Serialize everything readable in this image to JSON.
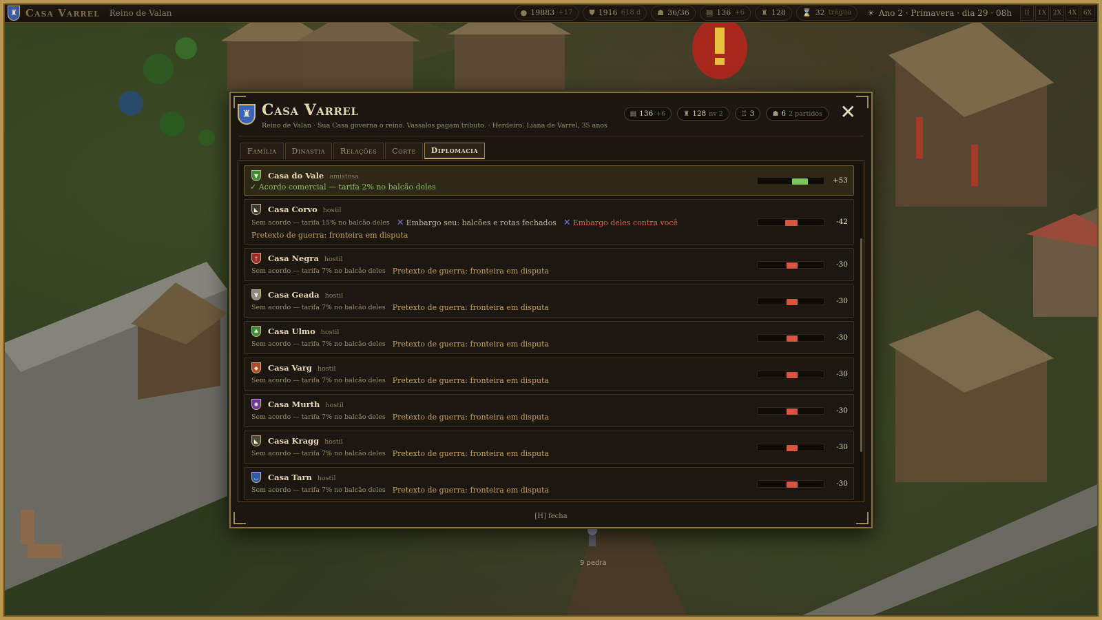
{
  "topbar": {
    "title": "Casa Varrel",
    "realm": "Reino de Valan",
    "stats": [
      {
        "icon": "gold-icon",
        "glyph": "●",
        "value": "19883",
        "delta": "+17"
      },
      {
        "icon": "shield-icon",
        "glyph": "⛊",
        "value": "1916",
        "delta": "618 d"
      },
      {
        "icon": "population-icon",
        "glyph": "☗",
        "value": "36/36",
        "delta": ""
      },
      {
        "icon": "scroll-icon",
        "glyph": "▤",
        "value": "136",
        "delta": "+6"
      },
      {
        "icon": "prestige-icon",
        "glyph": "♜",
        "value": "128",
        "delta": ""
      },
      {
        "icon": "hourglass-icon",
        "glyph": "⌛",
        "value": "32",
        "delta": "trégua"
      }
    ],
    "date": "Ano 2 · Primavera · dia 29 · 08h",
    "speeds": [
      "II",
      "1X",
      "2X",
      "4X",
      "6X"
    ]
  },
  "dialog": {
    "title": "Casa Varrel",
    "subtitle": "Reino de Valan · Sua Casa governa o reino. Vassalos pagam tributo. · Herdeiro: Liana de Varrel, 35 anos",
    "stats": [
      {
        "icon": "scroll-icon",
        "glyph": "▤",
        "value": "136",
        "delta": "+6"
      },
      {
        "icon": "prestige-icon",
        "glyph": "♜",
        "value": "128",
        "delta": "nv 2"
      },
      {
        "icon": "castle-icon",
        "glyph": "♖",
        "value": "3",
        "delta": ""
      },
      {
        "icon": "faction-icon",
        "glyph": "☗",
        "value": "6",
        "delta": "2 partidos"
      }
    ],
    "close_label": "✕",
    "tabs": [
      "Família",
      "Dinastia",
      "Relações",
      "Corte",
      "Diplomacia"
    ],
    "active_tab": 4,
    "footer_hint": "[H] fecha"
  },
  "houses": [
    {
      "name": "Casa do Vale",
      "status": "amistosa",
      "shield_color": "#3f8a3a",
      "shield_glyph": "▼",
      "friendly": true,
      "agreement": "✓ Acordo comercial — tarifa 2% no balcão deles",
      "relation": 53,
      "score": "+53"
    },
    {
      "name": "Casa Corvo",
      "status": "hostil",
      "shield_color": "#3a3a3a",
      "shield_glyph": "◣",
      "friendly": false,
      "tariff": "Sem acordo — tarifa 15% no balcão deles",
      "embargo_ours": "Embargo seu: balcões e rotas fechados",
      "embargo_theirs": "Embargo deles contra você",
      "casus": "Pretexto de guerra: fronteira em disputa",
      "relation": -42,
      "score": "-42"
    },
    {
      "name": "Casa Negra",
      "status": "hostil",
      "shield_color": "#9a2b2b",
      "shield_glyph": "†",
      "friendly": false,
      "tariff": "Sem acordo — tarifa 7% no balcão deles",
      "casus": "Pretexto de guerra: fronteira em disputa",
      "relation": -30,
      "score": "-30"
    },
    {
      "name": "Casa Geada",
      "status": "hostil",
      "shield_color": "#8a8a8a",
      "shield_glyph": "▼",
      "friendly": false,
      "tariff": "Sem acordo — tarifa 7% no balcão deles",
      "casus": "Pretexto de guerra: fronteira em disputa",
      "relation": -30,
      "score": "-30"
    },
    {
      "name": "Casa Ulmo",
      "status": "hostil",
      "shield_color": "#3e8a3a",
      "shield_glyph": "♣",
      "friendly": false,
      "tariff": "Sem acordo — tarifa 7% no balcão deles",
      "casus": "Pretexto de guerra: fronteira em disputa",
      "relation": -30,
      "score": "-30"
    },
    {
      "name": "Casa Varg",
      "status": "hostil",
      "shield_color": "#b24a2a",
      "shield_glyph": "◆",
      "friendly": false,
      "tariff": "Sem acordo — tarifa 7% no balcão deles",
      "casus": "Pretexto de guerra: fronteira em disputa",
      "relation": -30,
      "score": "-30"
    },
    {
      "name": "Casa Murth",
      "status": "hostil",
      "shield_color": "#6a3a9a",
      "shield_glyph": "✺",
      "friendly": false,
      "tariff": "Sem acordo — tarifa 7% no balcão deles",
      "casus": "Pretexto de guerra: fronteira em disputa",
      "relation": -30,
      "score": "-30"
    },
    {
      "name": "Casa Kragg",
      "status": "hostil",
      "shield_color": "#4a4a3a",
      "shield_glyph": "◣",
      "friendly": false,
      "tariff": "Sem acordo — tarifa 7% no balcão deles",
      "casus": "Pretexto de guerra: fronteira em disputa",
      "relation": -30,
      "score": "-30"
    },
    {
      "name": "Casa Tarn",
      "status": "hostil",
      "shield_color": "#2e5aa8",
      "shield_glyph": "◡",
      "friendly": false,
      "tariff": "Sem acordo — tarifa 7% no balcão deles",
      "casus": "Pretexto de guerra: fronteira em disputa",
      "relation": -30,
      "score": "-30"
    }
  ],
  "world": {
    "unit_label": "9 pedra"
  },
  "colors": {
    "friendly_bar": "#7ec75a",
    "hostile_bar": "#d9553f",
    "accent_gold": "#c9a45a"
  }
}
